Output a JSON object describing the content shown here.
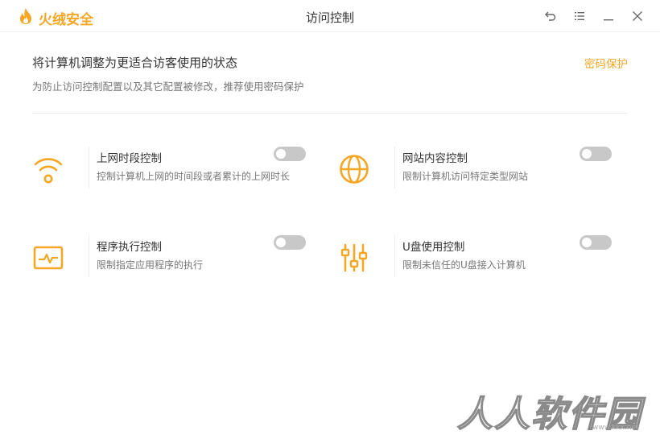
{
  "app": {
    "brand_name": "火绒安全",
    "window_title": "访问控制",
    "accent_color": "#f5a623"
  },
  "window_controls": [
    {
      "name": "back-icon"
    },
    {
      "name": "menu-icon"
    },
    {
      "name": "minimize-icon"
    },
    {
      "name": "close-icon"
    }
  ],
  "header": {
    "headline": "将计算机调整为更适合访客使用的状态",
    "subline": "为防止访问控制配置以及其它配置被修改，推荐使用密码保护",
    "password_link": "密码保护"
  },
  "features": [
    {
      "title": "上网时段控制",
      "desc": "控制计算机上网的时间段或者累计的上网时长",
      "icon": "wifi-icon",
      "enabled": false
    },
    {
      "title": "网站内容控制",
      "desc": "限制计算机访问特定类型网站",
      "icon": "globe-icon",
      "enabled": false
    },
    {
      "title": "程序执行控制",
      "desc": "限制指定应用程序的执行",
      "icon": "monitor-pulse-icon",
      "enabled": false
    },
    {
      "title": "U盘使用控制",
      "desc": "限制未信任的U盘接入计算机",
      "icon": "usb-sliders-icon",
      "enabled": false
    }
  ],
  "watermark": {
    "text": "人人软件园",
    "url": "www.kkx.net"
  }
}
